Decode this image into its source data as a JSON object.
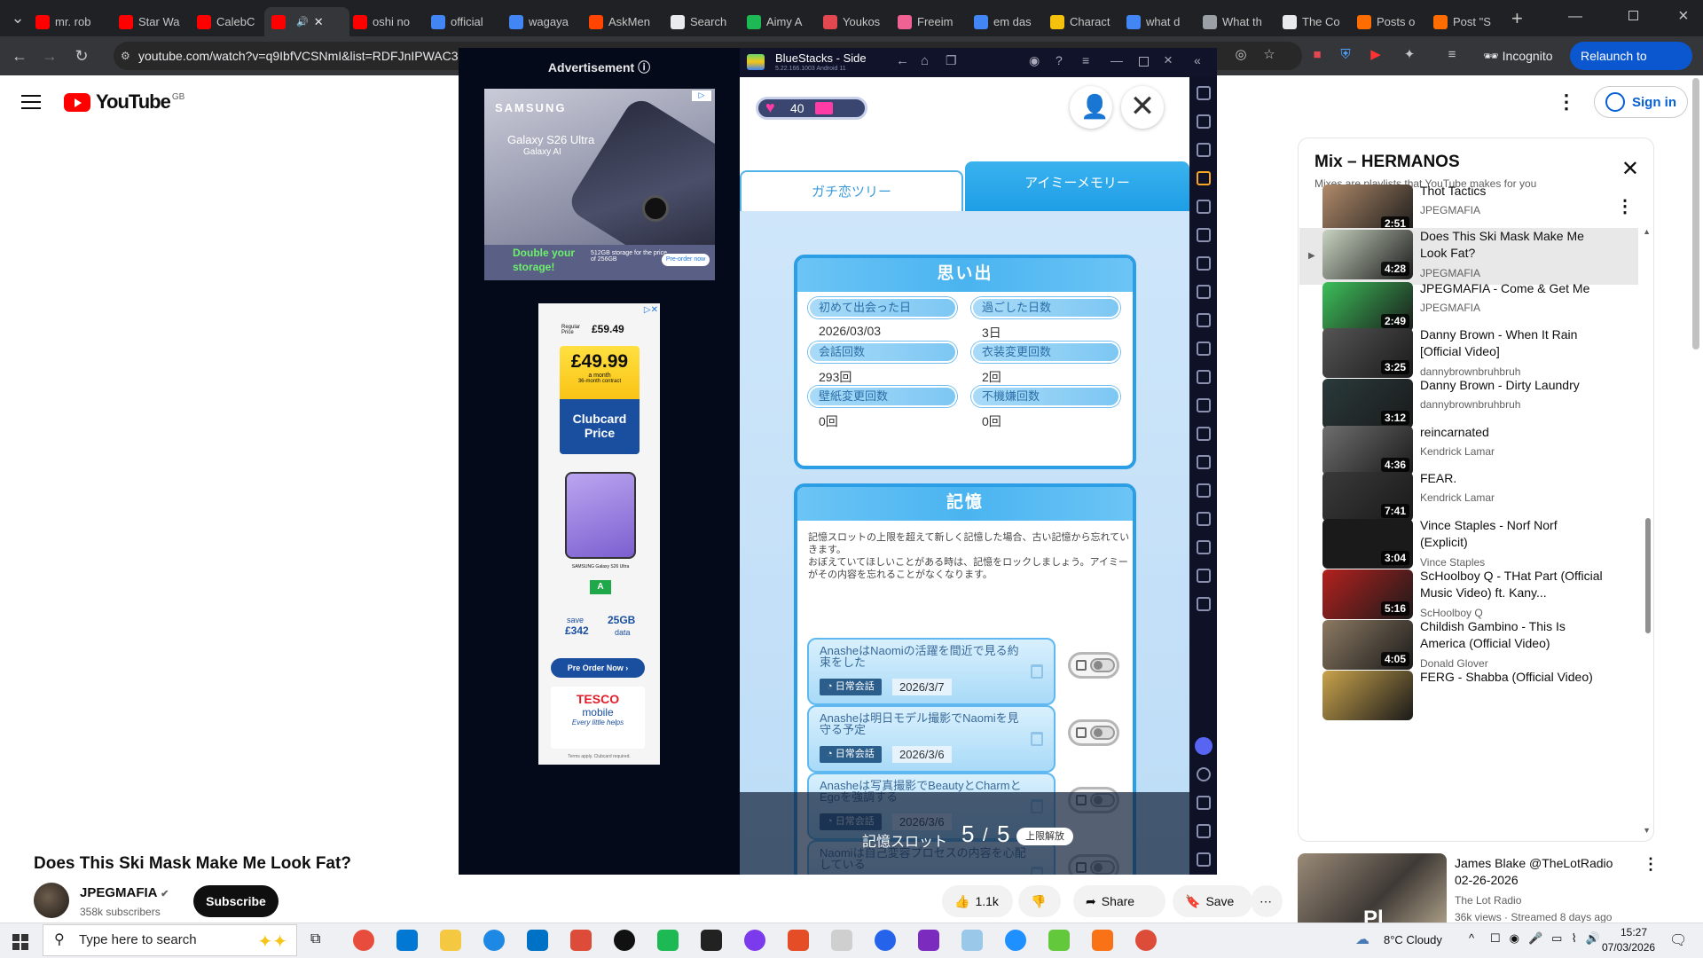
{
  "browser": {
    "tabs": [
      {
        "label": "mr. rob",
        "color": "#ff0000"
      },
      {
        "label": "Star Wa",
        "color": "#ff0000"
      },
      {
        "label": "CalebC",
        "color": "#ff0000"
      },
      {
        "label": "",
        "color": "#ff0000"
      },
      {
        "label": "oshi no",
        "color": "#ff0000"
      },
      {
        "label": "official",
        "color": "#4285f4"
      },
      {
        "label": "wagaya",
        "color": "#4285f4"
      },
      {
        "label": "AskMen",
        "color": "#ff4500"
      },
      {
        "label": "Search",
        "color": "#e8eaed"
      },
      {
        "label": "Aimy A",
        "color": "#1db954"
      },
      {
        "label": "Youkos",
        "color": "#e34850"
      },
      {
        "label": "Freeim",
        "color": "#f06292"
      },
      {
        "label": "em das",
        "color": "#4285f4"
      },
      {
        "label": "Charact",
        "color": "#f4c20d"
      },
      {
        "label": "what d",
        "color": "#4285f4"
      },
      {
        "label": "What th",
        "color": "#9aa0a6"
      },
      {
        "label": "The Co",
        "color": "#e8eaed"
      },
      {
        "label": "Posts o",
        "color": "#ff6d00"
      },
      {
        "label": "Post \"S",
        "color": "#ff6d00"
      }
    ],
    "url": "youtube.com/watch?v=q9IbfVCSNmI&list=RDFJnIPWAC3is",
    "incognito_label": "Incognito",
    "relaunch_label": "Relaunch to update",
    "badge_count": "1"
  },
  "youtube": {
    "logo_text": "YouTube",
    "region": "GB",
    "sign_in": "Sign in",
    "video_title": "Does This Ski Mask Make Me Look Fat?",
    "channel": "JPEGMAFIA",
    "subscribers": "358k subscribers",
    "subscribe": "Subscribe",
    "likes": "1.1k",
    "share": "Share",
    "save": "Save"
  },
  "mix": {
    "title": "Mix – HERMANOS",
    "subtitle": "Mixes are playlists that YouTube makes for you",
    "items": [
      {
        "title": "Thot Tactics",
        "channel": "JPEGMAFIA",
        "duration": "2:51",
        "color": "#b08a6a"
      },
      {
        "title": "Does This Ski Mask Make Me Look Fat?",
        "channel": "JPEGMAFIA",
        "duration": "4:28",
        "color": "#c8d3c0"
      },
      {
        "title": "JPEGMAFIA - Come & Get Me",
        "channel": "JPEGMAFIA",
        "duration": "2:49",
        "color": "#3cbf5a"
      },
      {
        "title": "Danny Brown - When It Rain [Official Video]",
        "channel": "dannybrownbruhbruh",
        "duration": "3:25",
        "color": "#555555"
      },
      {
        "title": "Danny Brown - Dirty Laundry",
        "channel": "dannybrownbruhbruh",
        "duration": "3:12",
        "color": "#2a3a3c"
      },
      {
        "title": "reincarnated",
        "channel": "Kendrick Lamar",
        "duration": "4:36",
        "color": "#6e6e6e"
      },
      {
        "title": "FEAR.",
        "channel": "Kendrick Lamar",
        "duration": "7:41",
        "color": "#3a3a3a"
      },
      {
        "title": "Vince Staples - Norf Norf (Explicit)",
        "channel": "Vince Staples",
        "duration": "3:04",
        "color": "#1a1a1a"
      },
      {
        "title": "ScHoolboy Q - THat Part (Official Music Video) ft. Kany...",
        "channel": "ScHoolboy Q",
        "duration": "5:16",
        "color": "#b3211f"
      },
      {
        "title": "Childish Gambino - This Is America (Official Video)",
        "channel": "Donald Glover",
        "duration": "4:05",
        "color": "#8c7a62"
      },
      {
        "title": "FERG - Shabba (Official Video)",
        "channel": "",
        "duration": "",
        "color": "#c9a34c"
      }
    ]
  },
  "side_video": {
    "title": "James Blake @TheLotRadio 02-26-2026",
    "channel": "The Lot Radio",
    "meta": "36k views · Streamed 8 days ago",
    "thumb_text": "Pl"
  },
  "ad": {
    "label": "Advertisement",
    "samsung": {
      "brand": "SAMSUNG",
      "model": "Galaxy S26 Ultra",
      "sub": "Galaxy AI",
      "cta_line1": "Double your",
      "cta_line2": "storage!",
      "storage": "512GB storage for the price of 256GB",
      "button": "Pre-order now"
    },
    "tesco": {
      "regular": "Regular Price",
      "regular_price": "£59.49",
      "price": "£49.99",
      "per": "a month",
      "contract": "36-month contract",
      "clubcard": "Clubcard Price",
      "phone_label": "SAMSUNG Galaxy S26 Ultra",
      "rating": "A",
      "save": "save",
      "save_amount": "£342",
      "data": "25GB",
      "data_word": "data",
      "button": "Pre Order Now",
      "brand1": "TESCO",
      "brand2": "mobile",
      "slogan": "Every little helps",
      "terms": "Terms apply. Clubcard required."
    }
  },
  "bluestacks": {
    "title": "BlueStacks - Side",
    "version": "5.22.166.1003  Android 11"
  },
  "game": {
    "hearts": "40",
    "tab_tree": "ガチ恋ツリー",
    "tab_memory": "アイミーメモリー",
    "memories_header": "思い出",
    "stats": [
      {
        "label": "初めて出会った日",
        "value": "2026/03/03"
      },
      {
        "label": "過ごした日数",
        "value": "3日"
      },
      {
        "label": "会話回数",
        "value": "293回"
      },
      {
        "label": "衣装変更回数",
        "value": "2回"
      },
      {
        "label": "壁紙変更回数",
        "value": "0回"
      },
      {
        "label": "不機嫌回数",
        "value": "0回"
      }
    ],
    "memory_header": "記憶",
    "memory_desc": "記憶スロットの上限を超えて新しく記憶した場合、古い記憶から忘れていきます。\nおぼえていてほしいことがある時は、記憶をロックしましょう。アイミーがその内容を忘れることがなくなります。",
    "memories": [
      {
        "text": "AnasheはNaomiの活躍を間近で見る約束をした",
        "tag": "日常会話",
        "date": "2026/3/7"
      },
      {
        "text": "Anasheは明日モデル撮影でNaomiを見守る予定",
        "tag": "日常会話",
        "date": "2026/3/6"
      },
      {
        "text": "Anasheは写真撮影でBeautyとCharmとEgoを強調する",
        "tag": "日常会話",
        "date": "2026/3/6"
      },
      {
        "text": "Naomiは自己変容プロセスの内容を心配している",
        "tag": "",
        "date": ""
      }
    ],
    "slot_label": "記憶スロット",
    "slot_used": "5",
    "slot_sep": "/",
    "slot_max": "5",
    "unlock": "上限解放"
  },
  "taskbar": {
    "search": "Type here to search",
    "weather": "8°C  Cloudy",
    "time": "15:27",
    "date": "07/03/2026",
    "notif": "1",
    "apps": [
      "#e74c3c",
      "#0078d4",
      "#f5c842",
      "#1e88e5",
      "#0072c6",
      "#dd4b39",
      "#111111",
      "#1db954",
      "#222222",
      "#7c3aed",
      "#e44d26",
      "#cfcfcf",
      "#2563eb",
      "#7b2cbf",
      "#9ac8e8",
      "#1e90ff",
      "#64c83c",
      "#f97316",
      "#dd4b39"
    ]
  }
}
